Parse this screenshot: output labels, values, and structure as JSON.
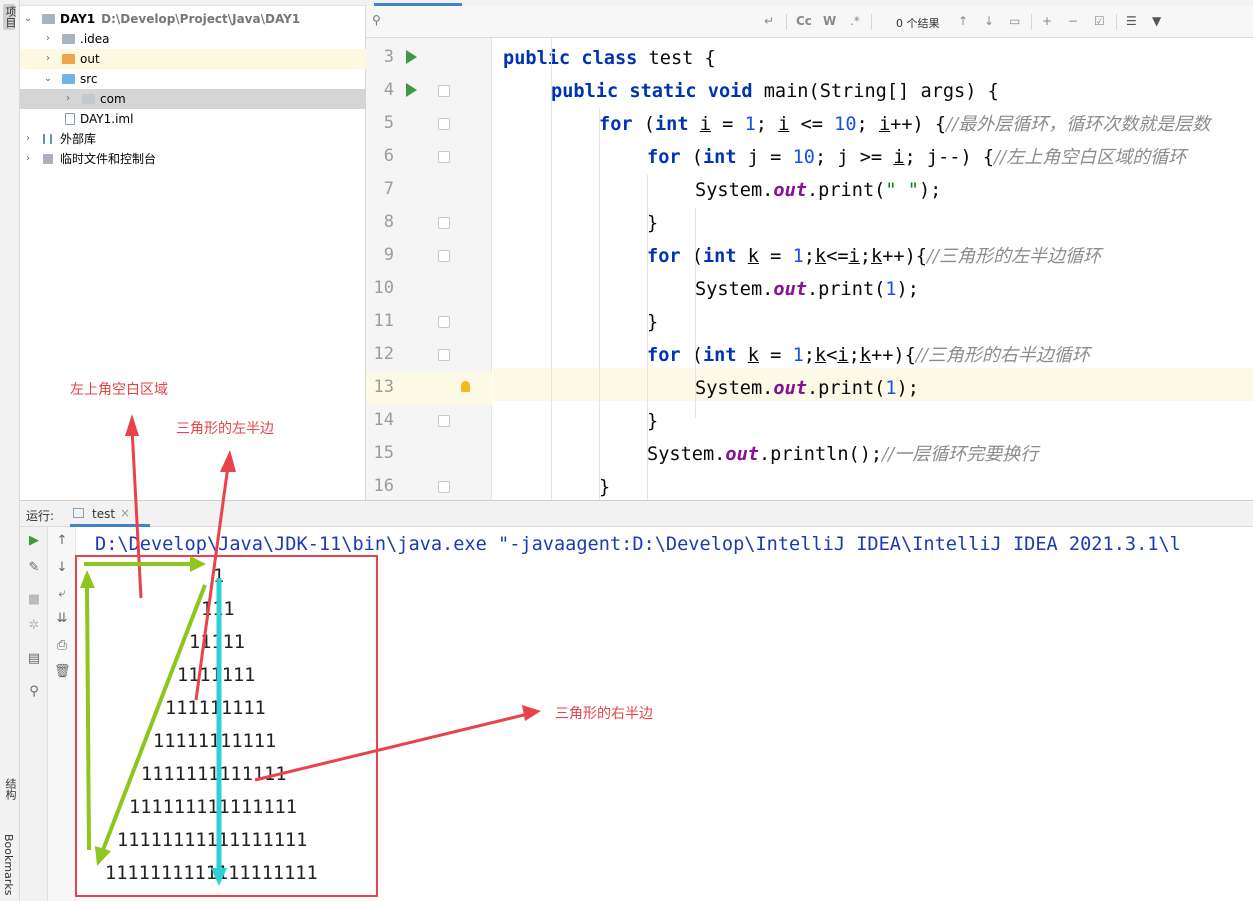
{
  "left_strip": {
    "project_label": "项目",
    "structure_label": "结构",
    "bookmarks_label": "Bookmarks"
  },
  "project_tree": {
    "items": [
      {
        "name": "DAY1",
        "path": "D:\\Develop\\Project\\Java\\DAY1",
        "icon": "module-folder-icon",
        "expanded": true
      },
      {
        "name": ".idea",
        "icon": "folder-icon",
        "expanded": false
      },
      {
        "name": "out",
        "icon": "excluded-folder-icon",
        "expanded": false
      },
      {
        "name": "src",
        "icon": "source-folder-icon",
        "expanded": true
      },
      {
        "name": "com",
        "icon": "package-icon",
        "expanded": false
      },
      {
        "name": "DAY1.iml",
        "icon": "iml-file-icon"
      },
      {
        "name": "外部库",
        "icon": "library-icon",
        "expanded": false
      },
      {
        "name": "临时文件和控制台",
        "icon": "scratch-icon",
        "expanded": false
      }
    ]
  },
  "editor": {
    "search": {
      "placeholder": "",
      "case_label": "Cc",
      "word_label": "W",
      "regex_label": ".*",
      "result_count": "0 个结果"
    },
    "line_numbers": [
      "3",
      "4",
      "5",
      "6",
      "7",
      "8",
      "9",
      "10",
      "11",
      "12",
      "13",
      "14",
      "15",
      "16"
    ],
    "current_line": "13",
    "lines": {
      "l3": {
        "kw1": "public",
        "kw2": "class",
        "rest": " test {"
      },
      "l4": {
        "kw1": "public",
        "kw2": "static",
        "kw3": "void",
        "rest": " main(String[] args) {"
      },
      "l5": {
        "kw": "for",
        "p1": " (",
        "kw2": "int",
        "p2": " ",
        "v1": "i",
        "p3": " = ",
        "n1": "1",
        "p4": "; ",
        "v2": "i",
        "p5": " <= ",
        "n2": "10",
        "p6": "; ",
        "v3": "i",
        "p7": "++) {",
        "comment": "//最外层循环，循环次数就是层数"
      },
      "l6": {
        "kw": "for",
        "p1": " (",
        "kw2": "int",
        "p2": " j = ",
        "n1": "10",
        "p3": "; j >= ",
        "v1": "i",
        "p4": "; j--) {",
        "comment": "//左上角空白区域的循环"
      },
      "l7": {
        "p1": "System.",
        "fld": "out",
        "p2": ".print(",
        "str": "\" \"",
        "p3": ");"
      },
      "l8": {
        "p1": "}"
      },
      "l9": {
        "kw": "for",
        "p1": " (",
        "kw2": "int",
        "p2": " ",
        "v1": "k",
        "p3": " = ",
        "n1": "1",
        "p4": ";",
        "v2": "k",
        "p5": "<=",
        "v3": "i",
        "p6": ";",
        "v4": "k",
        "p7": "++){",
        "comment": "//三角形的左半边循环"
      },
      "l10": {
        "p1": "System.",
        "fld": "out",
        "p2": ".print(",
        "n1": "1",
        "p3": ");"
      },
      "l11": {
        "p1": "}"
      },
      "l12": {
        "kw": "for",
        "p1": " (",
        "kw2": "int",
        "p2": " ",
        "v1": "k",
        "p3": " = ",
        "n1": "1",
        "p4": ";",
        "v2": "k",
        "p5": "<",
        "v3": "i",
        "p6": ";",
        "v4": "k",
        "p7": "++){",
        "comment": "//三角形的右半边循环"
      },
      "l13": {
        "p1": "System.",
        "fld": "out",
        "p2": ".print(",
        "n1": "1",
        "p3": ");"
      },
      "l14": {
        "p1": "}"
      },
      "l15": {
        "p1": "System.",
        "fld": "out",
        "p2": ".println();",
        "comment": "//一层循环完要换行"
      },
      "l16": {
        "p1": "}"
      }
    }
  },
  "run_panel": {
    "label": "运行:",
    "tab": "test",
    "command": "D:\\Develop\\Java\\JDK-11\\bin\\java.exe \"-javaagent:D:\\Develop\\IntelliJ IDEA\\IntelliJ IDEA 2021.3.1\\l",
    "output": [
      "1",
      "111",
      "11111",
      "1111111",
      "111111111",
      "11111111111",
      "1111111111111",
      "111111111111111",
      "11111111111111111",
      "1111111111111111111"
    ]
  },
  "annotations": {
    "blank_area": "左上角空白区域",
    "left_half": "三角形的左半边",
    "right_half": "三角形的右半边"
  },
  "colors": {
    "keyword": "#0033b3",
    "number": "#1750eb",
    "string": "#067d17",
    "field": "#871094",
    "comment": "#8c8c8c",
    "annotation_red": "#e8434a",
    "arrow_green": "#8cc61e",
    "arrow_cyan": "#2ad1d6",
    "current_line": "#fcfae6"
  }
}
